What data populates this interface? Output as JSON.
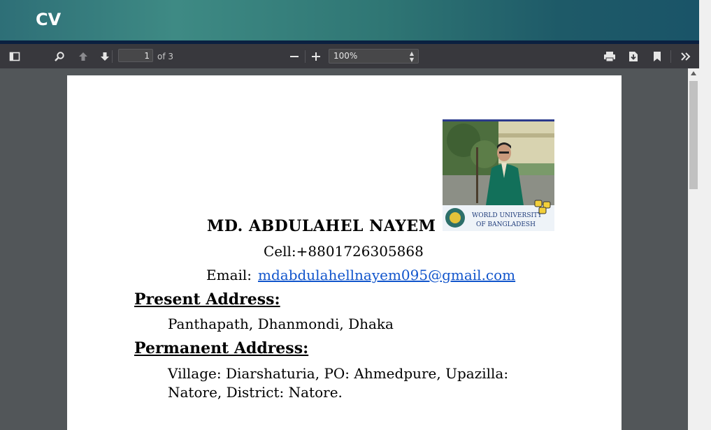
{
  "app": {
    "title": "CV"
  },
  "toolbar": {
    "page_number": "1",
    "page_count_label": "of 3",
    "zoom_value": "100%",
    "icons": [
      "sidebar-toggle-icon",
      "search-icon",
      "previous-page-icon",
      "next-page-icon",
      "zoom-out-icon",
      "zoom-in-icon",
      "print-icon",
      "download-icon",
      "bookmark-icon",
      "more-tools-icon"
    ]
  },
  "document": {
    "photo_caption_line1": "WORLD UNIVERSITY",
    "photo_caption_line2": "OF BANGLADESH",
    "name": "MD. ABDULAHEL NAYEM",
    "cell": "Cell:+8801726305868",
    "email_label": "Email:",
    "email": "mdabdulahellnayem095@gmail.com",
    "present_heading": "Present Address:",
    "present_address": "Panthapath, Dhanmondi, Dhaka",
    "permanent_heading": "Permanent Address:",
    "permanent_address": "Village: Diarshaturia, PO: Ahmedpure, Upazilla: Natore, District: Natore."
  },
  "colors": {
    "title_bar": "#2f7674",
    "toolbar": "#38383d",
    "viewer_bg": "#525659",
    "link": "#1155cc"
  }
}
